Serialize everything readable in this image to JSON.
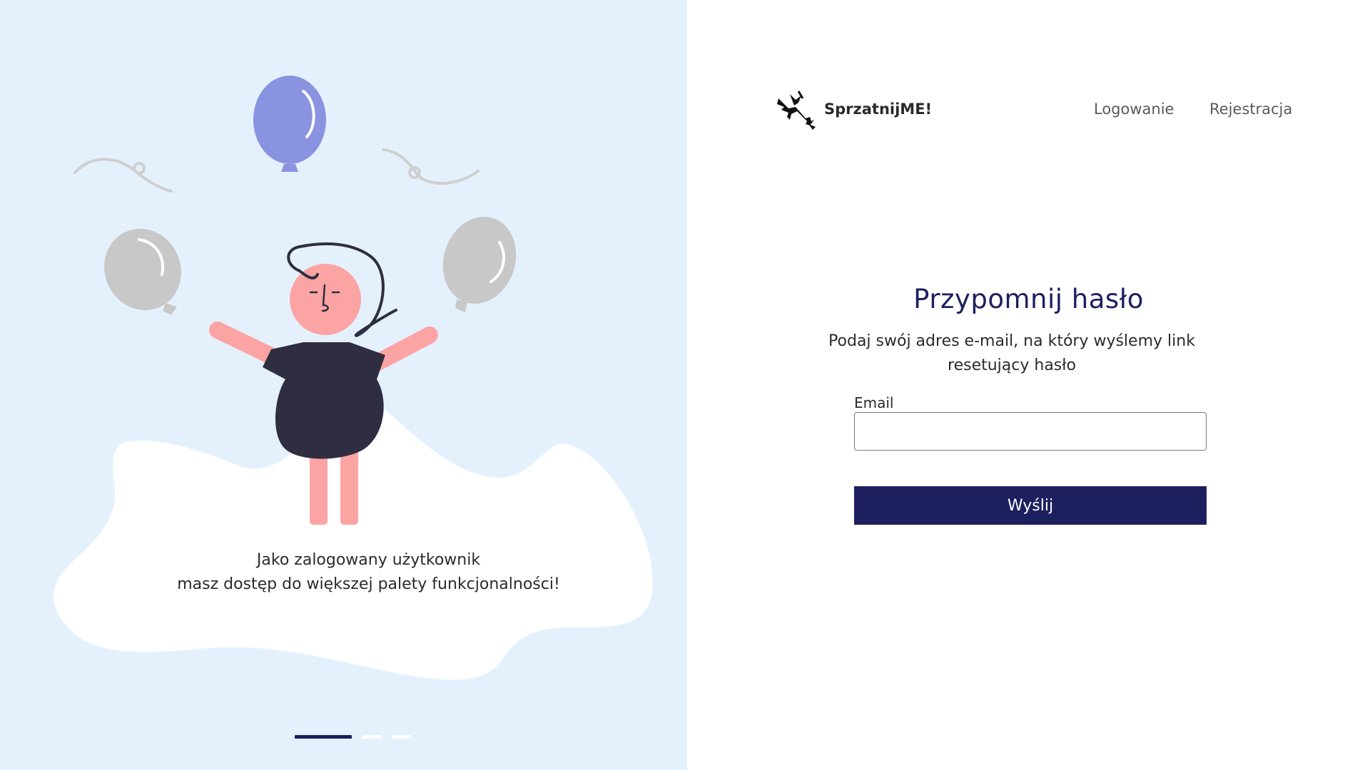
{
  "brand": {
    "name": "SprzatnijME!",
    "logo_icon": "witch-on-broom-icon"
  },
  "nav": {
    "login_label": "Logowanie",
    "register_label": "Rejestracja"
  },
  "form": {
    "title": "Przypomnij hasło",
    "description": "Podaj swój adres e-mail, na który wyślemy link resetujący hasło",
    "email_label": "Email",
    "email_value": "",
    "submit_label": "Wyślij"
  },
  "left_panel": {
    "caption_line1": "Jako zalogowany użytkownik",
    "caption_line2": "masz dostęp do większej palety funkcjonalności!",
    "carousel_slides": 3,
    "carousel_active_index": 0
  },
  "colors": {
    "accent": "#1d1f5f",
    "panel_bg": "#e4f1fd",
    "balloon_blue": "#8a93e0",
    "balloon_grey": "#c8c8c8",
    "skin": "#fca4a4",
    "dress": "#2f2e41"
  }
}
